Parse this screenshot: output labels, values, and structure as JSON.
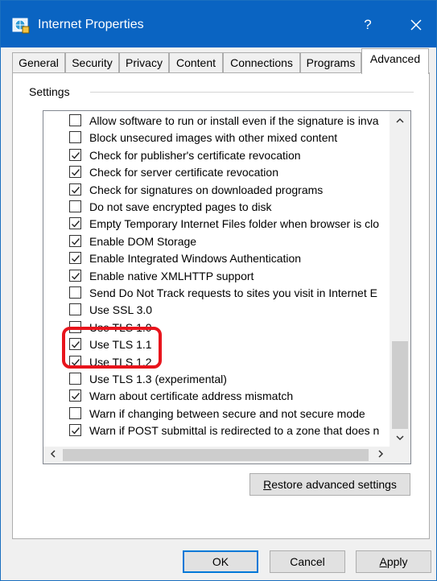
{
  "window": {
    "title": "Internet Properties",
    "help_label": "?",
    "close_label": "✕",
    "accent_color": "#0a64c2"
  },
  "tabs": [
    {
      "label": "General",
      "active": false
    },
    {
      "label": "Security",
      "active": false
    },
    {
      "label": "Privacy",
      "active": false
    },
    {
      "label": "Content",
      "active": false
    },
    {
      "label": "Connections",
      "active": false
    },
    {
      "label": "Programs",
      "active": false
    },
    {
      "label": "Advanced",
      "active": true
    }
  ],
  "settings": {
    "group_label": "Settings",
    "items": [
      {
        "label": "Allow software to run or install even if the signature is inva",
        "checked": false
      },
      {
        "label": "Block unsecured images with other mixed content",
        "checked": false
      },
      {
        "label": "Check for publisher's certificate revocation",
        "checked": true
      },
      {
        "label": "Check for server certificate revocation",
        "checked": true
      },
      {
        "label": "Check for signatures on downloaded programs",
        "checked": true
      },
      {
        "label": "Do not save encrypted pages to disk",
        "checked": false
      },
      {
        "label": "Empty Temporary Internet Files folder when browser is clo",
        "checked": true
      },
      {
        "label": "Enable DOM Storage",
        "checked": true
      },
      {
        "label": "Enable Integrated Windows Authentication",
        "checked": true
      },
      {
        "label": "Enable native XMLHTTP support",
        "checked": true
      },
      {
        "label": "Send Do Not Track requests to sites you visit in Internet E",
        "checked": false
      },
      {
        "label": "Use SSL 3.0",
        "checked": false
      },
      {
        "label": "Use TLS 1.0",
        "checked": false
      },
      {
        "label": "Use TLS 1.1",
        "checked": true
      },
      {
        "label": "Use TLS 1.2",
        "checked": true
      },
      {
        "label": "Use TLS 1.3 (experimental)",
        "checked": false
      },
      {
        "label": "Warn about certificate address mismatch",
        "checked": true
      },
      {
        "label": "Warn if changing between secure and not secure mode",
        "checked": false
      },
      {
        "label": "Warn if POST submittal is redirected to a zone that does n",
        "checked": true
      }
    ],
    "highlight_color": "#e8141c"
  },
  "buttons": {
    "restore": {
      "prefix": "R",
      "rest": "estore advanced settings"
    },
    "ok": "OK",
    "cancel": "Cancel",
    "apply": {
      "prefix": "A",
      "rest": "pply"
    }
  }
}
